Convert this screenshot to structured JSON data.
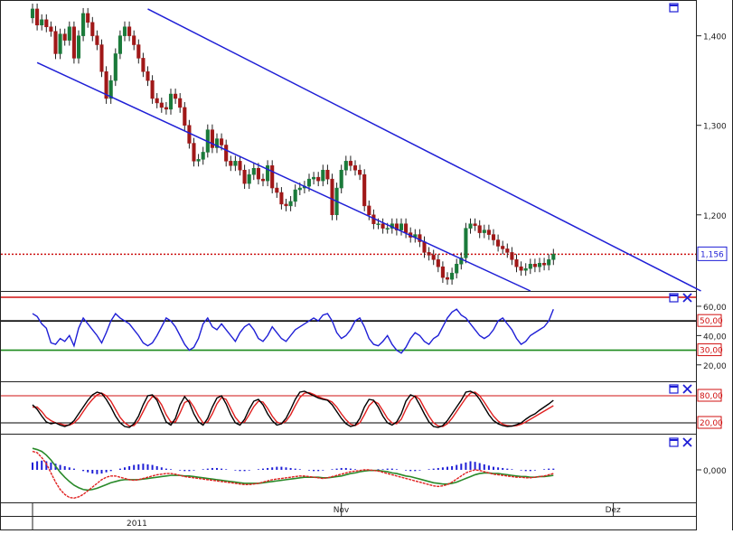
{
  "colors": {
    "up": "#1a7a3a",
    "down": "#a01818",
    "channel": "#1f1fd6",
    "rsi": "#1f1fd6",
    "stoch_k": "#000000",
    "stoch_d": "#e02020",
    "macd_hist": "#1f1fd6",
    "macd_line": "#e02020",
    "macd_signal": "#2a8a2a",
    "price_line": "#cc1111"
  },
  "icons": [
    "window-restore-icon",
    "close-x-icon"
  ],
  "x_axis": {
    "labels": [
      {
        "text": "Nov",
        "bar": 67
      },
      {
        "text": "Dez",
        "bar": 126
      }
    ],
    "year_label": "2011"
  },
  "chart_data": [
    {
      "type": "candlestick",
      "panel": "price",
      "yticks": [
        "1,400",
        "1,300",
        "1,200"
      ],
      "ytick_values": [
        1.4,
        1.3,
        1.2
      ],
      "ylim": [
        1.115,
        1.44
      ],
      "current_value_label": "1,156",
      "current_value": 1.156,
      "channel": {
        "upper": [
          [
            25,
            1.43
          ],
          [
            145,
            1.115
          ]
        ],
        "lower": [
          [
            1,
            1.37
          ],
          [
            108,
            1.115
          ]
        ]
      },
      "close": [
        1.43,
        1.412,
        1.418,
        1.41,
        1.405,
        1.38,
        1.402,
        1.395,
        1.41,
        1.375,
        1.4,
        1.425,
        1.415,
        1.4,
        1.39,
        1.36,
        1.33,
        1.35,
        1.38,
        1.4,
        1.41,
        1.4,
        1.39,
        1.375,
        1.36,
        1.35,
        1.33,
        1.325,
        1.32,
        1.318,
        1.335,
        1.33,
        1.32,
        1.3,
        1.28,
        1.26,
        1.262,
        1.27,
        1.295,
        1.275,
        1.285,
        1.278,
        1.26,
        1.255,
        1.26,
        1.25,
        1.235,
        1.245,
        1.252,
        1.24,
        1.238,
        1.255,
        1.23,
        1.225,
        1.212,
        1.21,
        1.215,
        1.228,
        1.23,
        1.232,
        1.24,
        1.242,
        1.238,
        1.25,
        1.24,
        1.2,
        1.23,
        1.25,
        1.26,
        1.255,
        1.25,
        1.245,
        1.21,
        1.2,
        1.19,
        1.19,
        1.185,
        1.185,
        1.19,
        1.183,
        1.19,
        1.18,
        1.175,
        1.178,
        1.17,
        1.158,
        1.155,
        1.15,
        1.142,
        1.13,
        1.128,
        1.135,
        1.145,
        1.152,
        1.185,
        1.19,
        1.188,
        1.18,
        1.183,
        1.178,
        1.172,
        1.165,
        1.162,
        1.158,
        1.15,
        1.142,
        1.138,
        1.14,
        1.145,
        1.142,
        1.146,
        1.144,
        1.15,
        1.156
      ],
      "open": [
        1.42,
        1.43,
        1.412,
        1.418,
        1.41,
        1.405,
        1.38,
        1.402,
        1.395,
        1.41,
        1.375,
        1.4,
        1.425,
        1.415,
        1.4,
        1.39,
        1.36,
        1.33,
        1.35,
        1.38,
        1.4,
        1.41,
        1.4,
        1.39,
        1.375,
        1.36,
        1.35,
        1.33,
        1.325,
        1.32,
        1.318,
        1.335,
        1.33,
        1.32,
        1.3,
        1.28,
        1.26,
        1.262,
        1.27,
        1.295,
        1.275,
        1.285,
        1.278,
        1.26,
        1.255,
        1.26,
        1.25,
        1.235,
        1.245,
        1.252,
        1.24,
        1.238,
        1.255,
        1.23,
        1.225,
        1.212,
        1.21,
        1.215,
        1.228,
        1.23,
        1.232,
        1.24,
        1.242,
        1.238,
        1.25,
        1.24,
        1.2,
        1.23,
        1.25,
        1.26,
        1.255,
        1.25,
        1.245,
        1.21,
        1.2,
        1.19,
        1.19,
        1.185,
        1.185,
        1.19,
        1.183,
        1.19,
        1.18,
        1.175,
        1.178,
        1.17,
        1.158,
        1.155,
        1.15,
        1.142,
        1.13,
        1.128,
        1.135,
        1.145,
        1.152,
        1.185,
        1.19,
        1.188,
        1.18,
        1.183,
        1.178,
        1.172,
        1.165,
        1.162,
        1.158,
        1.15,
        1.142,
        1.138,
        1.14,
        1.145,
        1.142,
        1.146,
        1.144,
        1.15
      ]
    },
    {
      "type": "line",
      "panel": "rsi",
      "yticks": [
        "60,00",
        "40,00",
        "20,00"
      ],
      "ytick_values": [
        60,
        40,
        20
      ],
      "ylim": [
        10,
        68
      ],
      "level_labels": [
        "50,00",
        "30,00"
      ],
      "levels": [
        50,
        30
      ],
      "series": [
        {
          "values": [
            55,
            53,
            48,
            45,
            35,
            34,
            38,
            36,
            40,
            33,
            45,
            52,
            48,
            44,
            40,
            35,
            42,
            50,
            55,
            52,
            50,
            48,
            44,
            40,
            35,
            33,
            35,
            40,
            46,
            52,
            50,
            46,
            40,
            34,
            30,
            32,
            38,
            48,
            52,
            46,
            44,
            48,
            44,
            40,
            36,
            42,
            46,
            48,
            44,
            38,
            36,
            40,
            46,
            42,
            38,
            36,
            40,
            44,
            46,
            48,
            50,
            52,
            50,
            54,
            55,
            50,
            42,
            38,
            40,
            44,
            50,
            52,
            46,
            38,
            34,
            33,
            36,
            40,
            34,
            30,
            28,
            32,
            38,
            42,
            40,
            36,
            34,
            38,
            40,
            46,
            52,
            56,
            58,
            54,
            52,
            48,
            44,
            40,
            38,
            40,
            44,
            50,
            52,
            48,
            44,
            38,
            34,
            36,
            40,
            42,
            44,
            46,
            50,
            58
          ]
        }
      ]
    },
    {
      "type": "line",
      "panel": "stochastic",
      "level_labels": [
        "80,00",
        "20,00"
      ],
      "levels": [
        80,
        20
      ],
      "ylim": [
        0,
        100
      ],
      "series": [
        {
          "values": [
            60,
            50,
            35,
            22,
            18,
            20,
            15,
            12,
            16,
            25,
            40,
            55,
            70,
            82,
            88,
            85,
            72,
            55,
            35,
            20,
            12,
            10,
            18,
            35,
            60,
            80,
            82,
            70,
            45,
            22,
            15,
            30,
            60,
            78,
            65,
            40,
            22,
            15,
            30,
            55,
            75,
            80,
            62,
            38,
            20,
            15,
            28,
            50,
            68,
            72,
            60,
            40,
            25,
            15,
            18,
            30,
            50,
            72,
            88,
            90,
            85,
            80,
            75,
            72,
            70,
            60,
            45,
            30,
            18,
            12,
            15,
            30,
            55,
            72,
            70,
            55,
            35,
            20,
            15,
            22,
            40,
            68,
            82,
            78,
            60,
            40,
            22,
            12,
            10,
            14,
            25,
            40,
            55,
            70,
            88,
            90,
            85,
            72,
            55,
            38,
            25,
            18,
            14,
            12,
            13,
            16,
            20,
            28,
            35,
            40,
            48,
            55,
            62,
            70
          ]
        },
        {
          "values": [
            55,
            55,
            45,
            32,
            25,
            20,
            18,
            15,
            15,
            20,
            30,
            45,
            60,
            72,
            82,
            86,
            80,
            68,
            50,
            32,
            20,
            13,
            14,
            25,
            45,
            65,
            78,
            75,
            60,
            38,
            22,
            22,
            42,
            65,
            70,
            55,
            35,
            20,
            22,
            40,
            62,
            76,
            72,
            52,
            32,
            20,
            22,
            38,
            56,
            68,
            66,
            52,
            35,
            22,
            18,
            24,
            38,
            58,
            76,
            86,
            87,
            83,
            78,
            74,
            71,
            66,
            55,
            40,
            27,
            17,
            14,
            20,
            38,
            58,
            68,
            63,
            47,
            30,
            20,
            18,
            28,
            50,
            70,
            80,
            72,
            53,
            35,
            20,
            13,
            12,
            18,
            30,
            45,
            60,
            75,
            86,
            88,
            80,
            66,
            50,
            35,
            24,
            17,
            14,
            13,
            14,
            17,
            22,
            28,
            34,
            40,
            46,
            52,
            58
          ]
        }
      ]
    },
    {
      "type": "macd",
      "panel": "macd",
      "ytick": "0,000",
      "ylim": [
        -0.05,
        0.05
      ],
      "histogram": [
        0.012,
        0.014,
        0.015,
        0.014,
        0.012,
        0.01,
        0.008,
        0.006,
        0.004,
        0.002,
        0.0,
        -0.002,
        -0.004,
        -0.006,
        -0.007,
        -0.006,
        -0.004,
        -0.002,
        0.0,
        0.002,
        0.004,
        0.006,
        0.008,
        0.009,
        0.01,
        0.009,
        0.008,
        0.006,
        0.004,
        0.002,
        0.001,
        0.0,
        -0.001,
        -0.002,
        -0.002,
        -0.001,
        0.0,
        0.001,
        0.002,
        0.003,
        0.003,
        0.002,
        0.001,
        0.0,
        -0.001,
        -0.002,
        -0.002,
        -0.001,
        0.0,
        0.001,
        0.002,
        0.003,
        0.004,
        0.005,
        0.005,
        0.004,
        0.003,
        0.002,
        0.001,
        0.0,
        -0.001,
        -0.002,
        -0.002,
        -0.001,
        0.0,
        0.001,
        0.002,
        0.003,
        0.003,
        0.002,
        0.001,
        0.0,
        -0.001,
        -0.001,
        0.0,
        0.001,
        0.001,
        0.002,
        0.002,
        0.001,
        0.0,
        -0.001,
        -0.002,
        -0.002,
        -0.001,
        0.0,
        0.001,
        0.002,
        0.003,
        0.004,
        0.005,
        0.006,
        0.008,
        0.01,
        0.012,
        0.014,
        0.013,
        0.011,
        0.009,
        0.007,
        0.005,
        0.004,
        0.003,
        0.002,
        0.001,
        0.0,
        -0.001,
        -0.002,
        -0.002,
        -0.001,
        0.0,
        0.001,
        0.002,
        0.002
      ],
      "macd": [
        0.03,
        0.028,
        0.02,
        0.01,
        -0.005,
        -0.02,
        -0.032,
        -0.04,
        -0.045,
        -0.046,
        -0.044,
        -0.04,
        -0.034,
        -0.028,
        -0.022,
        -0.016,
        -0.012,
        -0.01,
        -0.01,
        -0.012,
        -0.014,
        -0.016,
        -0.017,
        -0.016,
        -0.014,
        -0.012,
        -0.01,
        -0.008,
        -0.007,
        -0.006,
        -0.006,
        -0.007,
        -0.009,
        -0.011,
        -0.012,
        -0.013,
        -0.014,
        -0.015,
        -0.016,
        -0.017,
        -0.018,
        -0.019,
        -0.02,
        -0.021,
        -0.022,
        -0.023,
        -0.024,
        -0.024,
        -0.023,
        -0.022,
        -0.02,
        -0.018,
        -0.016,
        -0.015,
        -0.014,
        -0.013,
        -0.012,
        -0.011,
        -0.01,
        -0.01,
        -0.011,
        -0.012,
        -0.013,
        -0.014,
        -0.013,
        -0.011,
        -0.009,
        -0.007,
        -0.005,
        -0.003,
        -0.002,
        -0.001,
        0.0,
        0.0,
        -0.001,
        -0.002,
        -0.004,
        -0.006,
        -0.008,
        -0.01,
        -0.012,
        -0.014,
        -0.016,
        -0.018,
        -0.02,
        -0.022,
        -0.024,
        -0.026,
        -0.027,
        -0.026,
        -0.024,
        -0.02,
        -0.015,
        -0.01,
        -0.005,
        -0.002,
        0.0,
        -0.001,
        -0.003,
        -0.005,
        -0.007,
        -0.008,
        -0.009,
        -0.01,
        -0.011,
        -0.012,
        -0.012,
        -0.013,
        -0.013,
        -0.012,
        -0.011,
        -0.01,
        -0.008,
        -0.006
      ],
      "signal": [
        0.035,
        0.033,
        0.03,
        0.024,
        0.016,
        0.006,
        -0.004,
        -0.012,
        -0.019,
        -0.025,
        -0.029,
        -0.032,
        -0.033,
        -0.032,
        -0.03,
        -0.027,
        -0.024,
        -0.021,
        -0.019,
        -0.017,
        -0.016,
        -0.016,
        -0.016,
        -0.016,
        -0.015,
        -0.014,
        -0.013,
        -0.012,
        -0.011,
        -0.01,
        -0.009,
        -0.009,
        -0.009,
        -0.01,
        -0.01,
        -0.011,
        -0.012,
        -0.013,
        -0.014,
        -0.015,
        -0.016,
        -0.017,
        -0.018,
        -0.019,
        -0.02,
        -0.021,
        -0.022,
        -0.022,
        -0.022,
        -0.022,
        -0.021,
        -0.02,
        -0.019,
        -0.018,
        -0.017,
        -0.016,
        -0.015,
        -0.014,
        -0.013,
        -0.012,
        -0.012,
        -0.012,
        -0.012,
        -0.013,
        -0.013,
        -0.012,
        -0.011,
        -0.01,
        -0.008,
        -0.006,
        -0.005,
        -0.003,
        -0.002,
        -0.001,
        -0.001,
        -0.001,
        -0.002,
        -0.003,
        -0.005,
        -0.006,
        -0.008,
        -0.01,
        -0.011,
        -0.013,
        -0.015,
        -0.017,
        -0.019,
        -0.021,
        -0.022,
        -0.023,
        -0.023,
        -0.022,
        -0.02,
        -0.017,
        -0.014,
        -0.011,
        -0.008,
        -0.006,
        -0.005,
        -0.005,
        -0.006,
        -0.006,
        -0.007,
        -0.008,
        -0.009,
        -0.01,
        -0.011,
        -0.011,
        -0.012,
        -0.012,
        -0.011,
        -0.011,
        -0.01,
        -0.009
      ]
    }
  ]
}
